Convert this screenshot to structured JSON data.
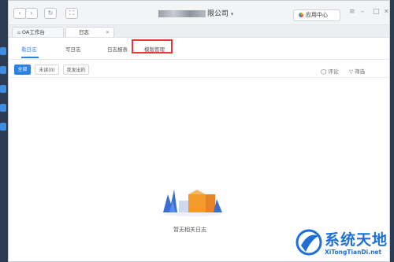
{
  "window": {
    "title_blurred_prefix": "██████",
    "title_suffix": "限公司",
    "title_dropdown": "▾",
    "app_center_label": "应用中心"
  },
  "nav": {
    "back": "‹",
    "forward": "›",
    "refresh": "↻",
    "fullscreen": "⛶"
  },
  "window_controls": {
    "menu": "≡",
    "minimize": "–",
    "maximize": "□",
    "close": "✕"
  },
  "tabs": [
    {
      "label": "OA工作台",
      "closable": false
    },
    {
      "label": "日志",
      "closable": true,
      "close_glyph": "✕"
    }
  ],
  "subnav": {
    "items": [
      "看日志",
      "写日志",
      "日志报表",
      "模版管理"
    ],
    "active_index": 0,
    "highlighted_index": 3
  },
  "filters": {
    "chips": [
      "全部",
      "未读(0)",
      "我发出的"
    ],
    "comment_label": "评论",
    "filter_label": "筛选"
  },
  "empty_state": {
    "message": "暂无相关日志"
  },
  "watermark": {
    "cn": "系统天地",
    "en": "XiTongTianDi.net"
  },
  "colors": {
    "accent": "#2d7fe0",
    "highlight": "#e5393a"
  }
}
